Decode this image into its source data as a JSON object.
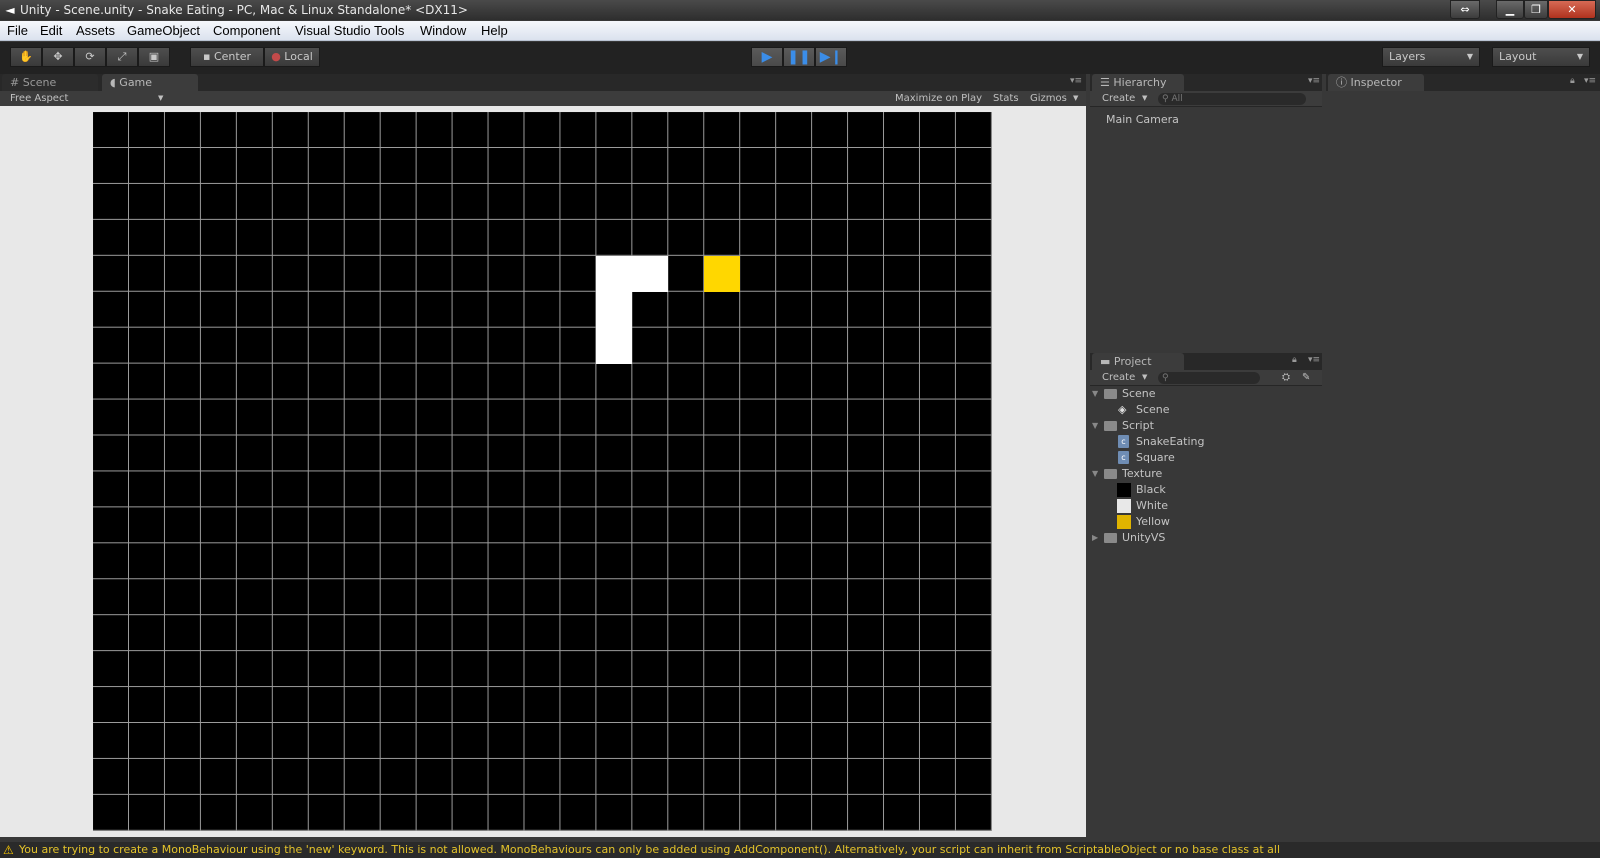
{
  "window": {
    "title": "Unity - Scene.unity - Snake Eating - PC, Mac & Linux Standalone* <DX11>",
    "icons": [
      "unity-logo-icon",
      "restore-arrows-icon",
      "minimize-icon",
      "maximize-icon",
      "close-icon"
    ]
  },
  "menu": [
    "File",
    "Edit",
    "Assets",
    "GameObject",
    "Component",
    "Visual Studio Tools",
    "Window",
    "Help"
  ],
  "toolbar": {
    "tools": [
      "hand-icon",
      "move-icon",
      "rotate-icon",
      "scale-icon",
      "rect-icon"
    ],
    "pivot_label": "Center",
    "space_label": "Local",
    "play": [
      "play-icon",
      "pause-icon",
      "step-icon"
    ],
    "layers_label": "Layers",
    "layout_label": "Layout"
  },
  "scene_tab": {
    "tabs": [
      {
        "label": "Scene",
        "icon": "grid-icon"
      },
      {
        "label": "Game",
        "icon": "pacman-icon"
      }
    ],
    "aspect": "Free Aspect",
    "maximize": "Maximize on Play",
    "stats": "Stats",
    "gizmos": "Gizmos"
  },
  "game": {
    "grid_cols": 25,
    "grid_rows": 20,
    "cell_color": "#000000",
    "line_color": "#9b9b9b",
    "snake_color": "#ffffff",
    "food_color": "#ffd700",
    "snake": [
      [
        14,
        4
      ],
      [
        15,
        4
      ],
      [
        14,
        5
      ],
      [
        14,
        6
      ]
    ],
    "food": [
      17,
      4
    ]
  },
  "hierarchy": {
    "tab": "Hierarchy",
    "create": "Create",
    "search_placeholder": "All",
    "items": [
      "Main Camera"
    ]
  },
  "project": {
    "tab": "Project",
    "create": "Create",
    "tree": [
      {
        "label": "Scene",
        "kind": "folder",
        "level": 0,
        "expanded": true
      },
      {
        "label": "Scene",
        "kind": "scene",
        "level": 1
      },
      {
        "label": "Script",
        "kind": "folder",
        "level": 0,
        "expanded": true
      },
      {
        "label": "SnakeEating",
        "kind": "script",
        "level": 1
      },
      {
        "label": "Square",
        "kind": "script",
        "level": 1
      },
      {
        "label": "Texture",
        "kind": "folder",
        "level": 0,
        "expanded": true
      },
      {
        "label": "Black",
        "kind": "texture",
        "level": 1,
        "color": "#000000"
      },
      {
        "label": "White",
        "kind": "texture",
        "level": 1,
        "color": "#e8e8e8"
      },
      {
        "label": "Yellow",
        "kind": "texture",
        "level": 1,
        "color": "#e0b400"
      },
      {
        "label": "UnityVS",
        "kind": "folder",
        "level": 0,
        "expanded": false
      }
    ]
  },
  "inspector": {
    "tab": "Inspector"
  },
  "console": {
    "message": "You are trying to create a MonoBehaviour using the 'new' keyword.  This is not allowed.  MonoBehaviours can only be added using AddComponent().  Alternatively, your script can inherit from ScriptableObject or no base class at all"
  }
}
